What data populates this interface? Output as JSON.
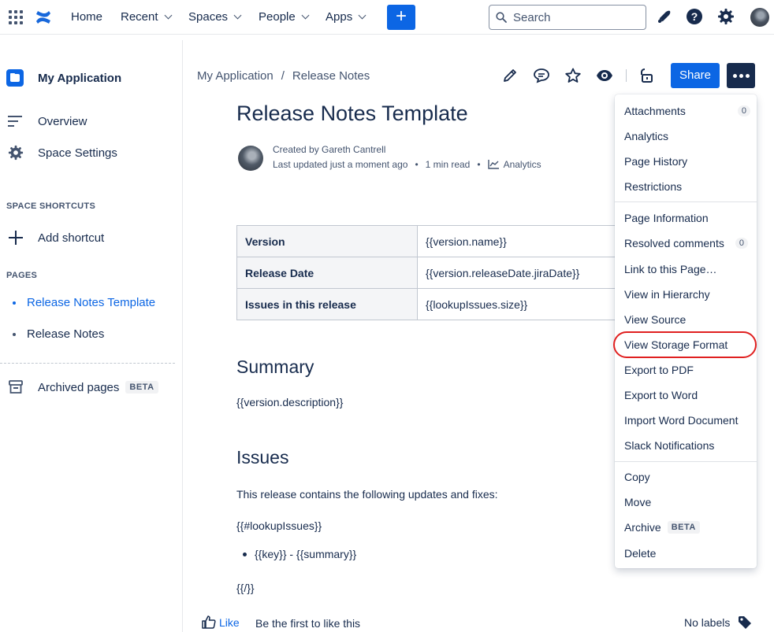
{
  "topnav": {
    "items": [
      {
        "label": "Home",
        "dropdown": false
      },
      {
        "label": "Recent",
        "dropdown": true
      },
      {
        "label": "Spaces",
        "dropdown": true
      },
      {
        "label": "People",
        "dropdown": true
      },
      {
        "label": "Apps",
        "dropdown": true
      }
    ],
    "create_label": "+",
    "search_placeholder": "Search",
    "icons": [
      "app-switcher-icon",
      "confluence-logo-icon",
      "notifications-icon",
      "help-icon",
      "settings-icon",
      "profile-avatar"
    ]
  },
  "sidebar": {
    "space_name": "My Application",
    "items": [
      {
        "label": "Overview",
        "icon": "overview-icon"
      },
      {
        "label": "Space Settings",
        "icon": "gear-icon"
      }
    ],
    "shortcuts_heading": "SPACE SHORTCUTS",
    "add_shortcut": "Add shortcut",
    "pages_heading": "PAGES",
    "pages": [
      {
        "label": "Release Notes Template",
        "active": true
      },
      {
        "label": "Release Notes",
        "active": false
      }
    ],
    "archived_label": "Archived pages",
    "archived_badge": "BETA"
  },
  "breadcrumb": {
    "parts": [
      "My Application",
      "/",
      "Release Notes"
    ]
  },
  "toolbar": {
    "share_label": "Share",
    "icons": [
      "edit-icon",
      "comment-icon",
      "star-icon",
      "watch-icon",
      "restrictions-icon",
      "more-actions-icon"
    ]
  },
  "page": {
    "title": "Release Notes Template",
    "created_by": "Created by Gareth Cantrell",
    "last_updated": "Last updated just a moment ago",
    "sep": "•",
    "read_time": "1 min read",
    "analytics_label": "Analytics",
    "table": [
      {
        "key": "Version",
        "value": "{{version.name}}"
      },
      {
        "key": "Release Date",
        "value": "{{version.releaseDate.jiraDate}}"
      },
      {
        "key": "Issues in this release",
        "value": "{{lookupIssues.size}}"
      }
    ],
    "summary_heading": "Summary",
    "summary_text": "{{version.description}}",
    "issues_heading": "Issues",
    "issues_intro": "This release contains the following updates and fixes:",
    "loop_start": "{{#lookupIssues}}",
    "bullet_item": "{{key}} - {{summary}}",
    "loop_end": "{{/}}"
  },
  "footer": {
    "like_label": "Like",
    "like_text": "Be the first to like this",
    "labels_text": "No labels"
  },
  "menu": {
    "group1": [
      {
        "label": "Attachments",
        "count": "0"
      },
      {
        "label": "Analytics"
      },
      {
        "label": "Page History"
      },
      {
        "label": "Restrictions"
      }
    ],
    "group2": [
      {
        "label": "Page Information"
      },
      {
        "label": "Resolved comments",
        "count": "0"
      },
      {
        "label": "Link to this Page…"
      },
      {
        "label": "View in Hierarchy"
      },
      {
        "label": "View Source"
      },
      {
        "label": "View Storage Format",
        "highlighted": true
      },
      {
        "label": "Export to PDF"
      },
      {
        "label": "Export to Word"
      },
      {
        "label": "Import Word Document"
      },
      {
        "label": "Slack Notifications"
      }
    ],
    "group3": [
      {
        "label": "Copy"
      },
      {
        "label": "Move"
      },
      {
        "label": "Archive",
        "badge": "BETA"
      },
      {
        "label": "Delete"
      }
    ]
  },
  "colors": {
    "accent": "#0c66e4",
    "text": "#172b4d",
    "subtle": "#44546f",
    "highlight_ring": "#e02020"
  }
}
